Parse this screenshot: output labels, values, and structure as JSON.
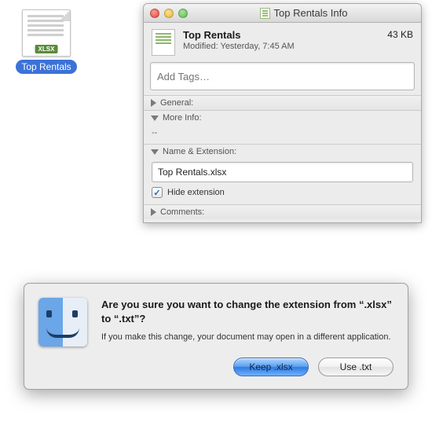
{
  "desktop": {
    "file_label": "Top Rentals",
    "badge": "XLSX"
  },
  "info_window": {
    "title": "Top Rentals Info",
    "file_name": "Top Rentals",
    "modified_line": "Modified: Yesterday, 7:45 AM",
    "size": "43 KB",
    "tags_placeholder": "Add Tags…",
    "sections": {
      "general": "General:",
      "more_info": "More Info:",
      "more_info_body": "--",
      "name_ext": "Name & Extension:",
      "comments": "Comments:"
    },
    "name_value": "Top Rentals.xlsx",
    "hide_ext_label": "Hide extension",
    "hide_ext_checked": true
  },
  "dialog": {
    "title": "Are you sure you want to change the extension from “.xlsx” to “.txt”?",
    "message": "If you make this change, your document may open in a different application.",
    "keep_button": "Keep .xlsx",
    "use_button": "Use .txt"
  }
}
